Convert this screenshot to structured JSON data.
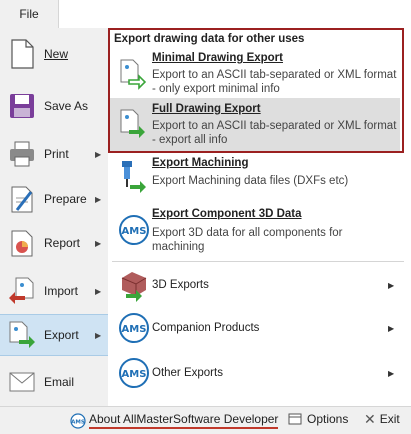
{
  "file_tab": {
    "label": "File"
  },
  "left_menu": [
    {
      "label": "New",
      "icon": "new-document-icon",
      "has_arrow": false
    },
    {
      "label": "Save As",
      "icon": "save-as-icon",
      "has_arrow": false
    },
    {
      "label": "Print",
      "icon": "printer-icon",
      "has_arrow": true
    },
    {
      "label": "Prepare",
      "icon": "prepare-document-icon",
      "has_arrow": true
    },
    {
      "label": "Report",
      "icon": "report-chart-icon",
      "has_arrow": true
    },
    {
      "label": "Import",
      "icon": "import-icon",
      "has_arrow": true
    },
    {
      "label": "Export",
      "icon": "export-icon",
      "has_arrow": true,
      "active": true
    },
    {
      "label": "Email",
      "icon": "email-icon",
      "has_arrow": false
    }
  ],
  "submenu": {
    "header": "Export drawing data for other uses",
    "items": [
      {
        "title": "Minimal Drawing Export",
        "desc_line1": "Export to an ASCII tab-separated or XML format",
        "desc_line2": "- only export minimal info",
        "icon": "export-minimal-icon"
      },
      {
        "title": "Full Drawing Export",
        "desc_line1": "Export to an ASCII tab-separated or XML format",
        "desc_line2": "- export all info",
        "icon": "export-full-icon",
        "highlighted": true
      },
      {
        "title": "Export Machining",
        "desc_line1": "Export Machining data files (DXFs etc)",
        "desc_line2": "",
        "icon": "export-machining-icon"
      },
      {
        "title": "Export Component 3D Data",
        "desc_line1": "Export 3D data for all components for",
        "desc_line2": "machining",
        "icon": "ams-logo-icon"
      }
    ],
    "rows": [
      {
        "label": "3D Exports",
        "icon": "3d-exports-icon"
      },
      {
        "label": "Companion Products",
        "icon": "ams-logo-icon"
      },
      {
        "label": "Other Exports",
        "icon": "ams-logo-icon"
      }
    ]
  },
  "bottom_bar": {
    "about": "About AllMasterSoftware Developer",
    "options": "Options",
    "exit": "Exit"
  },
  "colors": {
    "accent_red": "#9b2020",
    "active_blue": "#cfe3f3",
    "ams_blue": "#1f6fb5",
    "green_arrow": "#3aa53a"
  }
}
